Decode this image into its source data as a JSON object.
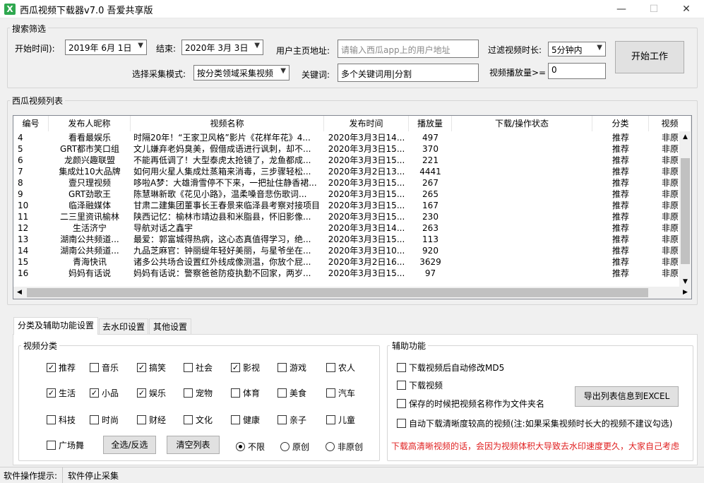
{
  "window": {
    "title": "西瓜视频下载器v7.0 吾爱共享版",
    "app_icon": "X",
    "minimize": "—",
    "maximize": "☐",
    "close": "✕"
  },
  "filter": {
    "legend": "搜索筛选",
    "start_label": "开始时间):",
    "start_value": "2019年  6月  1日",
    "end_label": "结束:",
    "end_value": "2020年  3月  3日",
    "homepage_label": "用户主页地址:",
    "homepage_placeholder": "请输入西瓜app上的用户地址",
    "duration_label": "过滤视频时长:",
    "duration_value": "5分钟内",
    "mode_label": "选择采集模式:",
    "mode_value": "按分类领域采集视频",
    "keyword_label": "关键词:",
    "keyword_value": "多个关键词用|分割",
    "plays_label": "视频播放量>=",
    "plays_value": "0",
    "start_button": "开始工作"
  },
  "list": {
    "legend": "西瓜视频列表",
    "columns": [
      "编号",
      "发布人昵称",
      "视频名称",
      "发布时间",
      "播放量",
      "下载/操作状态",
      "分类",
      "视频"
    ],
    "rows": [
      [
        "4",
        "看看最娱乐",
        "时隔20年！“王家卫风格”影片《花样年花》4...",
        "2020年3月3日14...",
        "497",
        "",
        "推荐",
        "非原"
      ],
      [
        "5",
        "GRT都市笑口组",
        "文儿嫌弃老妈臭美，假借成语进行讽刺，却不...",
        "2020年3月3日15...",
        "370",
        "",
        "推荐",
        "非原"
      ],
      [
        "6",
        "龙颜兴趣联盟",
        "不能再低调了！大型泰虎太抢镜了，龙鱼都成...",
        "2020年3月3日15...",
        "221",
        "",
        "推荐",
        "非原"
      ],
      [
        "7",
        "集成灶10大品牌",
        "如何用火星人集成灶蒸箱来消毒，三步骤轻松...",
        "2020年3月2日13...",
        "4441",
        "",
        "推荐",
        "非原"
      ],
      [
        "8",
        "壹只理视频",
        "哆啦A梦：大雄滑雪停不下来，一把扯住静香裙...",
        "2020年3月3日15...",
        "267",
        "",
        "推荐",
        "非原"
      ],
      [
        "9",
        "GRT劲歌王",
        "陈慧琳新歌《花见小路》，温柔嗓音悲伤歌词...",
        "2020年3月3日15...",
        "265",
        "",
        "推荐",
        "非原"
      ],
      [
        "10",
        "临泽融媒体",
        "甘肃二建集团董事长王春景来临泽县考察对接项目",
        "2020年3月3日15...",
        "167",
        "",
        "推荐",
        "非原"
      ],
      [
        "11",
        "二三里资讯榆林",
        "陕西记忆：榆林市靖边县和米脂县，怀旧影像...",
        "2020年3月3日15...",
        "230",
        "",
        "推荐",
        "非原"
      ],
      [
        "12",
        "生活济宁",
        "导航对话之鑫宇",
        "2020年3月3日14...",
        "263",
        "",
        "推荐",
        "非原"
      ],
      [
        "13",
        "湖南公共频道...",
        "最爱：郭富城得热病，这心态真值得学习，绝...",
        "2020年3月3日15...",
        "113",
        "",
        "推荐",
        "非原"
      ],
      [
        "14",
        "湖南公共频道...",
        "九品芝麻官：钟丽缇年轻好美丽，与星爷坐在...",
        "2020年3月3日10...",
        "920",
        "",
        "推荐",
        "非原"
      ],
      [
        "15",
        "青海快讯",
        "诸多公共场合设置红外线成像测温，你放个屁...",
        "2020年3月2日16...",
        "3629",
        "",
        "推荐",
        "非原"
      ],
      [
        "16",
        "妈妈有话说",
        "妈妈有话说：警察爸爸防疫执勤不回家，两岁...",
        "2020年3月3日15...",
        "97",
        "",
        "推荐",
        "非原"
      ]
    ]
  },
  "tabs": [
    "分类及辅助功能设置",
    "去水印设置",
    "其他设置"
  ],
  "categories": {
    "legend": "视频分类",
    "items": [
      {
        "label": "推荐",
        "checked": true
      },
      {
        "label": "音乐",
        "checked": false
      },
      {
        "label": "搞笑",
        "checked": true
      },
      {
        "label": "社会",
        "checked": false
      },
      {
        "label": "影视",
        "checked": true
      },
      {
        "label": "游戏",
        "checked": false
      },
      {
        "label": "农人",
        "checked": false
      },
      {
        "label": "生活",
        "checked": true
      },
      {
        "label": "小品",
        "checked": true
      },
      {
        "label": "娱乐",
        "checked": true
      },
      {
        "label": "宠物",
        "checked": false
      },
      {
        "label": "体育",
        "checked": false
      },
      {
        "label": "美食",
        "checked": false
      },
      {
        "label": "汽车",
        "checked": false
      },
      {
        "label": "科技",
        "checked": false
      },
      {
        "label": "时尚",
        "checked": false
      },
      {
        "label": "财经",
        "checked": false
      },
      {
        "label": "文化",
        "checked": false
      },
      {
        "label": "健康",
        "checked": false
      },
      {
        "label": "亲子",
        "checked": false
      },
      {
        "label": "儿童",
        "checked": false
      },
      {
        "label": "广场舞",
        "checked": false
      }
    ],
    "select_all_button": "全选/反选",
    "clear_button": "清空列表",
    "radios": [
      {
        "label": "不限",
        "selected": true
      },
      {
        "label": "原创",
        "selected": false
      },
      {
        "label": "非原创",
        "selected": false
      }
    ]
  },
  "aux": {
    "legend": "辅助功能",
    "options": [
      "下载视频后自动修改MD5",
      "下载视频",
      "保存的时候把视频名称作为文件夹名",
      "自动下载清晰度较高的视频(注:如果采集视频时长大的视频不建议勾选)"
    ],
    "export_button": "导出列表信息到EXCEL",
    "warning": "下载高清晰视频的话，会因为视频体积大导致去水印速度更久，大家自己考虑",
    "warning_color": "#e02020"
  },
  "status": {
    "label": "软件操作提示:",
    "value": "软件停止采集"
  }
}
